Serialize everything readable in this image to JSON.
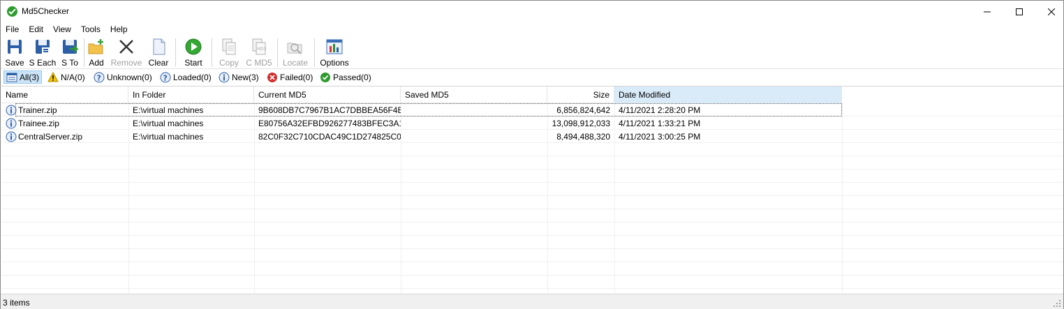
{
  "window": {
    "title": "Md5Checker"
  },
  "menu": [
    "File",
    "Edit",
    "View",
    "Tools",
    "Help"
  ],
  "toolbar": {
    "save": "Save",
    "save_each": "S Each",
    "save_to": "S To",
    "add": "Add",
    "remove": "Remove",
    "clear": "Clear",
    "start": "Start",
    "copy": "Copy",
    "copy_md5": "C MD5",
    "locate": "Locate",
    "options": "Options"
  },
  "filters": {
    "all": "All(3)",
    "na": "N/A(0)",
    "unknown": "Unknown(0)",
    "loaded": "Loaded(0)",
    "new": "New(3)",
    "failed": "Failed(0)",
    "passed": "Passed(0)"
  },
  "table": {
    "columns": [
      "Name",
      "In Folder",
      "Current MD5",
      "Saved MD5",
      "Size",
      "Date Modified"
    ],
    "rows": [
      {
        "name": "Trainer.zip",
        "folder": "E:\\virtual machines",
        "current_md5": "9B608DB7C7967B1AC7DBBEA56F4E...",
        "saved_md5": "",
        "size": "6,856,824,642",
        "date": "4/11/2021 2:28:20 PM"
      },
      {
        "name": "Trainee.zip",
        "folder": "E:\\virtual machines",
        "current_md5": "E80756A32EFBD926277483BFEC3A1...",
        "saved_md5": "",
        "size": "13,098,912,033",
        "date": "4/11/2021 1:33:21 PM"
      },
      {
        "name": "CentralServer.zip",
        "folder": "E:\\virtual machines",
        "current_md5": "82C0F32C710CDAC49C1D274825C0...",
        "saved_md5": "",
        "size": "8,494,488,320",
        "date": "4/11/2021 3:00:25 PM"
      }
    ]
  },
  "status": {
    "text": "3 items"
  },
  "colors": {
    "accent": "#cce4f7",
    "green": "#2e9b2e",
    "red": "#d32f2f",
    "warning": "#f5c400"
  }
}
